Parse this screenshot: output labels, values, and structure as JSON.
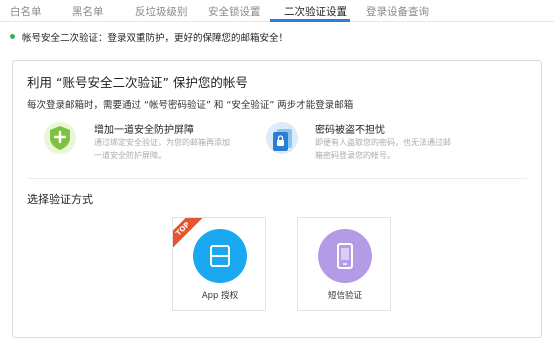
{
  "tabs": [
    {
      "label": "白名单",
      "active": false
    },
    {
      "label": "黑名单",
      "active": false
    },
    {
      "label": "反垃圾级别",
      "active": false
    },
    {
      "label": "安全锁设置",
      "active": false
    },
    {
      "label": "二次验证设置",
      "active": true
    },
    {
      "label": "登录设备查询",
      "active": false
    }
  ],
  "notice": {
    "text": "帐号安全二次验证：登录双重防护，更好的保障您的邮箱安全！"
  },
  "panel": {
    "title": "利用 “账号安全二次验证” 保护您的帐号",
    "subtitle": "每次登录邮箱时，需要通过 “帐号密码验证” 和 “安全验证” 两步才能登录邮箱",
    "features": [
      {
        "icon": "shield-plus-icon",
        "title": "增加一道安全防护屏障",
        "desc": "通过绑定安全验证，为您的邮箱再添加一道安全防护屏障。"
      },
      {
        "icon": "lock-document-icon",
        "title": "密码被盗不担忧",
        "desc": "即便有人盗取您的密码，也无法通过邮箱密码登录您的帐号。"
      }
    ],
    "choose_title": "选择验证方式",
    "methods": [
      {
        "label": "App 授权",
        "badge": "TOP",
        "icon": "app-auth-icon",
        "color": "#1aa8f0"
      },
      {
        "label": "短信验证",
        "icon": "phone-icon",
        "color": "#b49be6"
      }
    ]
  }
}
